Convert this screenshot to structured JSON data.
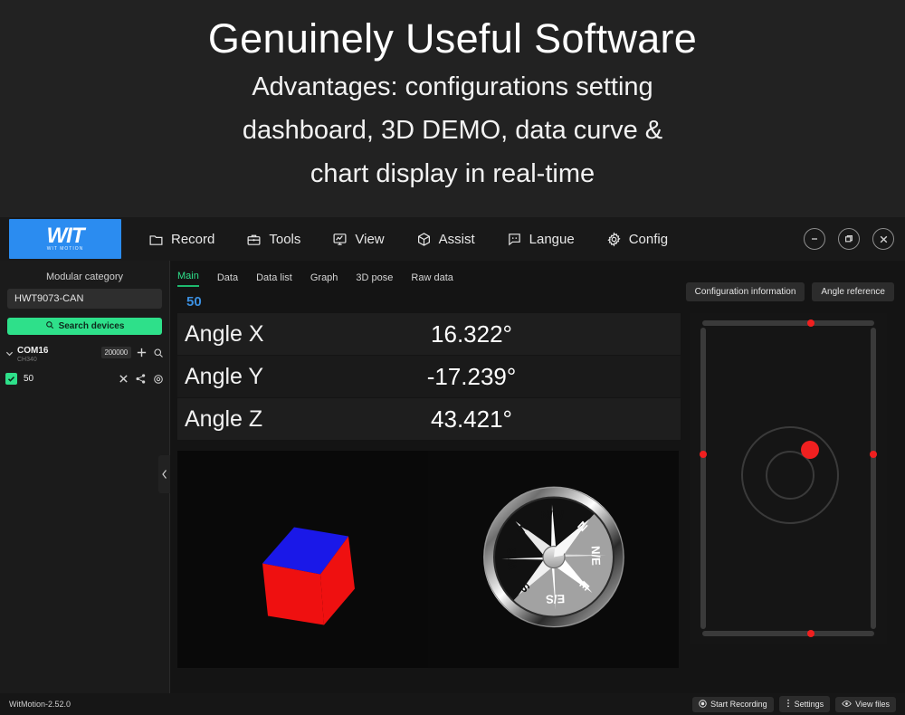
{
  "promo": {
    "headline": "Genuinely Useful Software",
    "lines": [
      "Advantages: configurations setting",
      "dashboard, 3D DEMO, data curve &",
      "chart display in real-time"
    ]
  },
  "titlebar": {
    "logo_word": "WIT",
    "logo_sub": "WIT MOTION",
    "menu": [
      {
        "label": "Record",
        "icon": "folder-icon"
      },
      {
        "label": "Tools",
        "icon": "toolbox-icon"
      },
      {
        "label": "View",
        "icon": "monitor-chart-icon"
      },
      {
        "label": "Assist",
        "icon": "cube-icon"
      },
      {
        "label": "Langue",
        "icon": "chat-icon"
      },
      {
        "label": "Config",
        "icon": "gear-icon"
      }
    ],
    "window_controls": [
      {
        "name": "minimize-button",
        "glyph": "−"
      },
      {
        "name": "restore-button",
        "glyph": "❐"
      },
      {
        "name": "close-button",
        "glyph": "✕"
      }
    ]
  },
  "sidebar": {
    "title": "Modular category",
    "module_value": "HWT9073-CAN",
    "search_label": "Search devices",
    "port": {
      "name": "COM16",
      "chip": "CH340",
      "baud": "200000"
    },
    "device": {
      "id": "50",
      "checked": true
    },
    "collapse_glyph": "‹"
  },
  "main": {
    "tabs": [
      {
        "label": "Main",
        "active": true
      },
      {
        "label": "Data",
        "active": false
      },
      {
        "label": "Data list",
        "active": false
      },
      {
        "label": "Graph",
        "active": false
      },
      {
        "label": "3D pose",
        "active": false
      },
      {
        "label": "Raw data",
        "active": false
      }
    ],
    "device_label": "50",
    "top_buttons": [
      {
        "label": "Configuration information"
      },
      {
        "label": "Angle reference"
      }
    ],
    "angles": [
      {
        "name": "Angle X",
        "value": "16.322°"
      },
      {
        "name": "Angle Y",
        "value": "-17.239°"
      },
      {
        "name": "Angle Z",
        "value": "43.421°"
      }
    ],
    "compass_labels": [
      "N/E",
      "E",
      "E/S",
      "S",
      "W/S",
      "W",
      "N/W",
      "N"
    ],
    "level": {
      "markers": [
        "top",
        "right",
        "bottom",
        "left"
      ],
      "bubble_color": "#f02020"
    }
  },
  "statusbar": {
    "version": "WitMotion-2.52.0",
    "buttons": [
      {
        "label": "Start Recording",
        "icon": "record-icon"
      },
      {
        "label": "Settings",
        "icon": "dots-vertical-icon"
      },
      {
        "label": "View files",
        "icon": "eye-icon"
      }
    ]
  },
  "colors": {
    "accent_green": "#2ee08a",
    "accent_blue": "#2b8cf0",
    "device_blue": "#3b8fe0",
    "marker_red": "#f01f1f",
    "cube_red": "#ef1010",
    "cube_blue": "#1a18e8"
  }
}
